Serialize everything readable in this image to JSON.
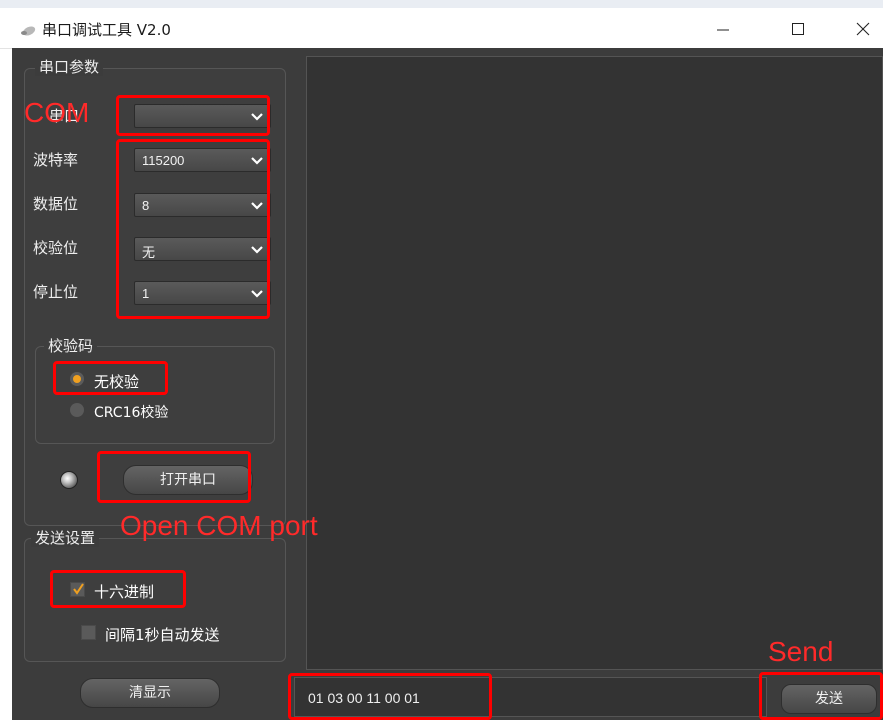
{
  "window": {
    "title": "串口调试工具 V2.0"
  },
  "serial_params": {
    "title": "串口参数",
    "rows": [
      {
        "label": "串口",
        "value": ""
      },
      {
        "label": "波特率",
        "value": "115200"
      },
      {
        "label": "数据位",
        "value": "8"
      },
      {
        "label": "校验位",
        "value": "无"
      },
      {
        "label": "停止位",
        "value": "1"
      }
    ],
    "checksum": {
      "title": "校验码",
      "options": [
        {
          "label": "无校验",
          "selected": true
        },
        {
          "label": "CRC16校验",
          "selected": false
        }
      ]
    },
    "open_button": "打开串口"
  },
  "send_settings": {
    "title": "发送设置",
    "hex": {
      "label": "十六进制",
      "checked": true
    },
    "auto": {
      "label": "间隔1秒自动发送",
      "checked": false
    }
  },
  "clear_button": "清显示",
  "send_input": "01 03 00 11 00 01",
  "send_button": "发送",
  "annotations": {
    "com": "COM",
    "open": "Open COM port",
    "send": "Send"
  },
  "colors": {
    "highlight": "#ff0000",
    "accent": "#f0a020"
  }
}
